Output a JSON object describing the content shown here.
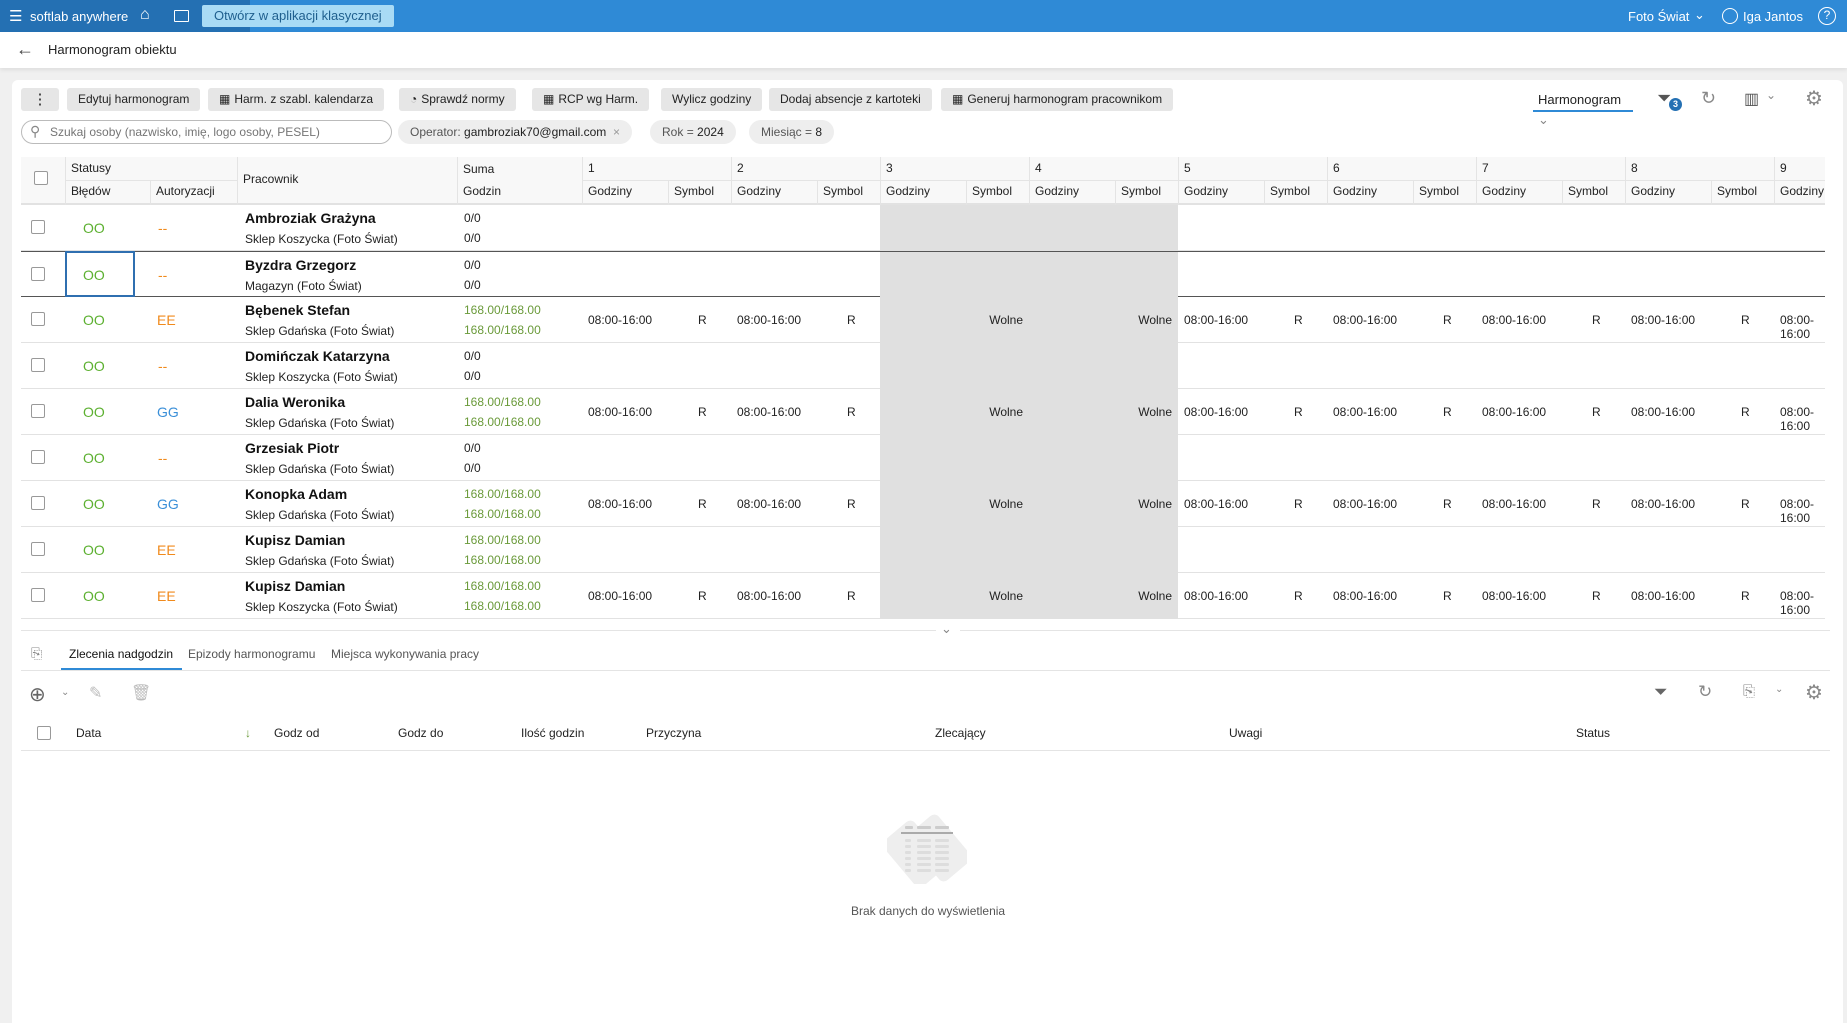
{
  "topbar": {
    "brand": "softlab anywhere",
    "open_classic": "Otwórz w aplikacji klasycznej",
    "company": "Foto Świat",
    "user": "Iga Jantos"
  },
  "page": {
    "title": "Harmonogram obiektu"
  },
  "toolbar": {
    "buttons": [
      "Edytuj harmonogram",
      "Harm. z szabl. kalendarza",
      "Sprawdź normy",
      "RCP wg Harm.",
      "Wylicz godziny",
      "Dodaj absencje z kartoteki",
      "Generuj harmonogram pracownikom"
    ],
    "view_select": "Harmonogram",
    "filter_count": "3"
  },
  "search": {
    "placeholder": "Szukaj osoby (nazwisko, imię, logo osoby, PESEL)"
  },
  "filters": {
    "operator_label": "Operator:",
    "operator_value": "gambroziak70@gmail.com",
    "year_label": "Rok",
    "year_value": "2024",
    "month_label": "Miesiąc",
    "month_value": "8",
    "eq": "="
  },
  "grid": {
    "headers": {
      "statusy": "Statusy",
      "bledow": "Błędów",
      "autoryzacji": "Autoryzacji",
      "pracownik": "Pracownik",
      "suma": "Suma",
      "godzin": "Godzin",
      "godziny": "Godziny",
      "symbol": "Symbol"
    },
    "days": [
      "1",
      "2",
      "3",
      "4",
      "5",
      "6",
      "7",
      "8",
      "9"
    ],
    "weekend_days": [
      "3",
      "4"
    ],
    "rows": [
      {
        "name": "Ambroziak Grażyna",
        "place": "Sklep Koszycka (Foto Świat)",
        "bledow": "OO",
        "autoryzacji": "--",
        "auth_color": "#f08a1c",
        "suma1": "0/0",
        "suma2": "0/0",
        "schedule": false
      },
      {
        "name": "Byzdra Grzegorz",
        "place": "Magazyn (Foto Świat)",
        "bledow": "OO",
        "autoryzacji": "--",
        "auth_color": "#f08a1c",
        "suma1": "0/0",
        "suma2": "0/0",
        "schedule": false,
        "selected": true
      },
      {
        "name": "Bębenek Stefan",
        "place": "Sklep Gdańska (Foto Świat)",
        "bledow": "OO",
        "autoryzacji": "EE",
        "auth_color": "#f08a1c",
        "suma1": "168.00/168.00",
        "suma2": "168.00/168.00",
        "schedule": true
      },
      {
        "name": "Domińczak Katarzyna",
        "place": "Sklep Koszycka (Foto Świat)",
        "bledow": "OO",
        "autoryzacji": "--",
        "auth_color": "#f08a1c",
        "suma1": "0/0",
        "suma2": "0/0",
        "schedule": false
      },
      {
        "name": "Dalia Weronika",
        "place": "Sklep Gdańska (Foto Świat)",
        "bledow": "OO",
        "autoryzacji": "GG",
        "auth_color": "#3a8fd8",
        "suma1": "168.00/168.00",
        "suma2": "168.00/168.00",
        "schedule": true
      },
      {
        "name": "Grzesiak Piotr",
        "place": "Sklep Gdańska (Foto Świat)",
        "bledow": "OO",
        "autoryzacji": "--",
        "auth_color": "#f08a1c",
        "suma1": "0/0",
        "suma2": "0/0",
        "schedule": false
      },
      {
        "name": "Konopka Adam",
        "place": "Sklep Gdańska (Foto Świat)",
        "bledow": "OO",
        "autoryzacji": "GG",
        "auth_color": "#3a8fd8",
        "suma1": "168.00/168.00",
        "suma2": "168.00/168.00",
        "schedule": true
      },
      {
        "name": "Kupisz Damian",
        "place": "Sklep Gdańska (Foto Świat)",
        "bledow": "OO",
        "autoryzacji": "EE",
        "auth_color": "#f08a1c",
        "suma1": "168.00/168.00",
        "suma2": "168.00/168.00",
        "schedule": false
      },
      {
        "name": "Kupisz Damian",
        "place": "Sklep Koszycka (Foto Świat)",
        "bledow": "OO",
        "autoryzacji": "EE",
        "auth_color": "#f08a1c",
        "suma1": "168.00/168.00",
        "suma2": "168.00/168.00",
        "schedule": true
      }
    ],
    "work_hours": "08:00-16:00",
    "work_symbol": "R",
    "off_symbol": "Wolne"
  },
  "colors": {
    "ok": "#5cb030",
    "sum_green": "#6a9a3a",
    "accent": "#2f8ad6"
  },
  "bottom": {
    "tabs": [
      "Zlecenia nadgodzin",
      "Epizody harmonogramu",
      "Miejsca wykonywania pracy"
    ],
    "columns": [
      "Data",
      "Godz od",
      "Godz do",
      "Ilość godzin",
      "Przyczyna",
      "Zlecający",
      "Uwagi",
      "Status"
    ],
    "empty": "Brak danych do wyświetlenia"
  }
}
